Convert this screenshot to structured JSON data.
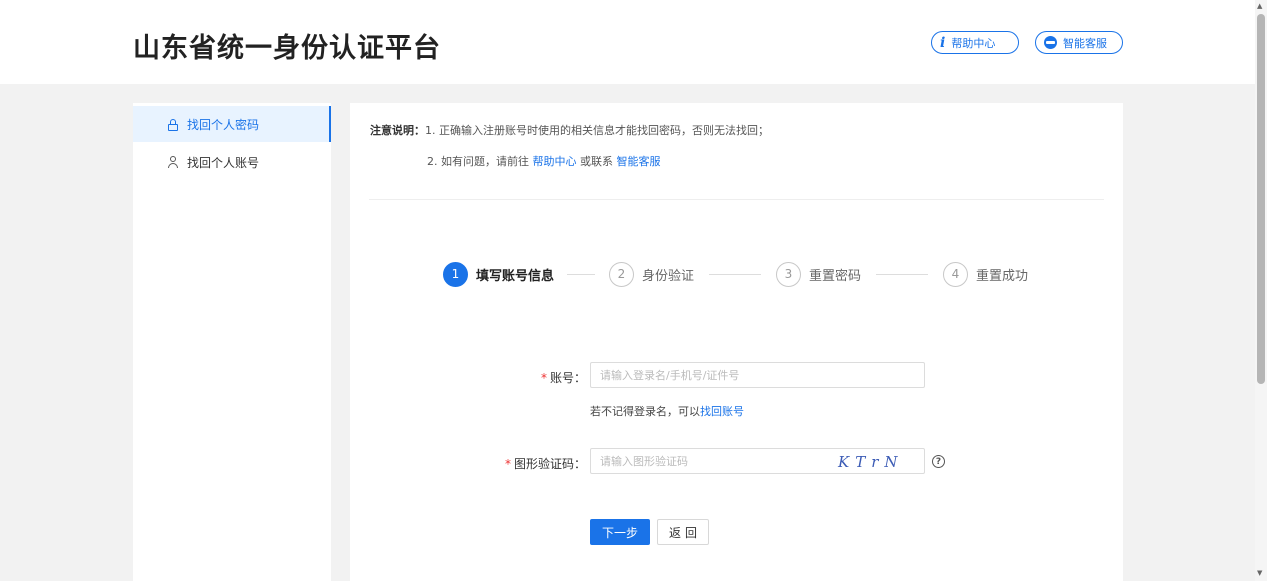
{
  "header": {
    "title": "山东省统一身份认证平台",
    "help_label": "帮助中心",
    "service_label": "智能客服",
    "help_icon": "info-icon",
    "service_icon": "customer-service-icon"
  },
  "sidebar": {
    "items": [
      {
        "label": "找回个人密码",
        "icon": "lock-icon",
        "active": true
      },
      {
        "label": "找回个人账号",
        "icon": "user-icon",
        "active": false
      }
    ]
  },
  "notice": {
    "label": "注意说明：",
    "line1": "1. 正确输入注册账号时使用的相关信息才能找回密码，否则无法找回；",
    "line2_prefix": "2. 如有问题，请前往",
    "line2_link1": "帮助中心",
    "line2_middle": "或联系",
    "line2_link2": "智能客服"
  },
  "steps": [
    {
      "num": "1",
      "label": "填写账号信息",
      "active": true
    },
    {
      "num": "2",
      "label": "身份验证",
      "active": false
    },
    {
      "num": "3",
      "label": "重置密码",
      "active": false
    },
    {
      "num": "4",
      "label": "重置成功",
      "active": false
    }
  ],
  "form": {
    "account": {
      "label": "账号：",
      "placeholder": "请输入登录名/手机号/证件号",
      "value": ""
    },
    "hint_prefix": "若不记得登录名，可以",
    "hint_link": "找回账号",
    "captcha": {
      "label": "图形验证码：",
      "placeholder": "请输入图形验证码",
      "value": "",
      "image_text": "KTrN"
    },
    "required_mark": "*",
    "help_mark": "?"
  },
  "buttons": {
    "next": "下一步",
    "back": "返回"
  },
  "colors": {
    "accent": "#1a73e8",
    "required": "#e33333"
  }
}
